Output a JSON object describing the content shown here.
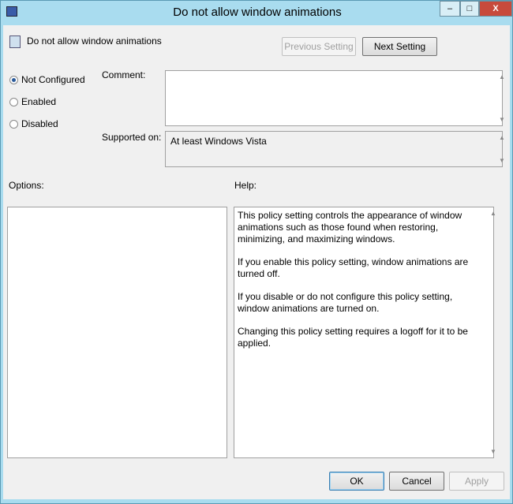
{
  "window": {
    "title": "Do not allow window animations",
    "minimize": "–",
    "maximize": "□",
    "close": "X"
  },
  "header": {
    "policy_name": "Do not allow window animations",
    "previous": "Previous Setting",
    "next": "Next Setting"
  },
  "state": {
    "options": [
      "Not Configured",
      "Enabled",
      "Disabled"
    ],
    "selected": "Not Configured"
  },
  "comment": {
    "label": "Comment:",
    "value": ""
  },
  "supported": {
    "label": "Supported on:",
    "value": "At least Windows Vista"
  },
  "options_label": "Options:",
  "help_label": "Help:",
  "help": [
    "This policy setting controls the appearance of window animations such as those found when restoring, minimizing, and maximizing windows.",
    "If you enable this policy setting, window animations are turned off.",
    "If you disable or do not configure this policy setting, window animations are turned on.",
    "Changing this policy setting requires a logoff for it to be applied."
  ],
  "footer": {
    "ok": "OK",
    "cancel": "Cancel",
    "apply": "Apply"
  }
}
